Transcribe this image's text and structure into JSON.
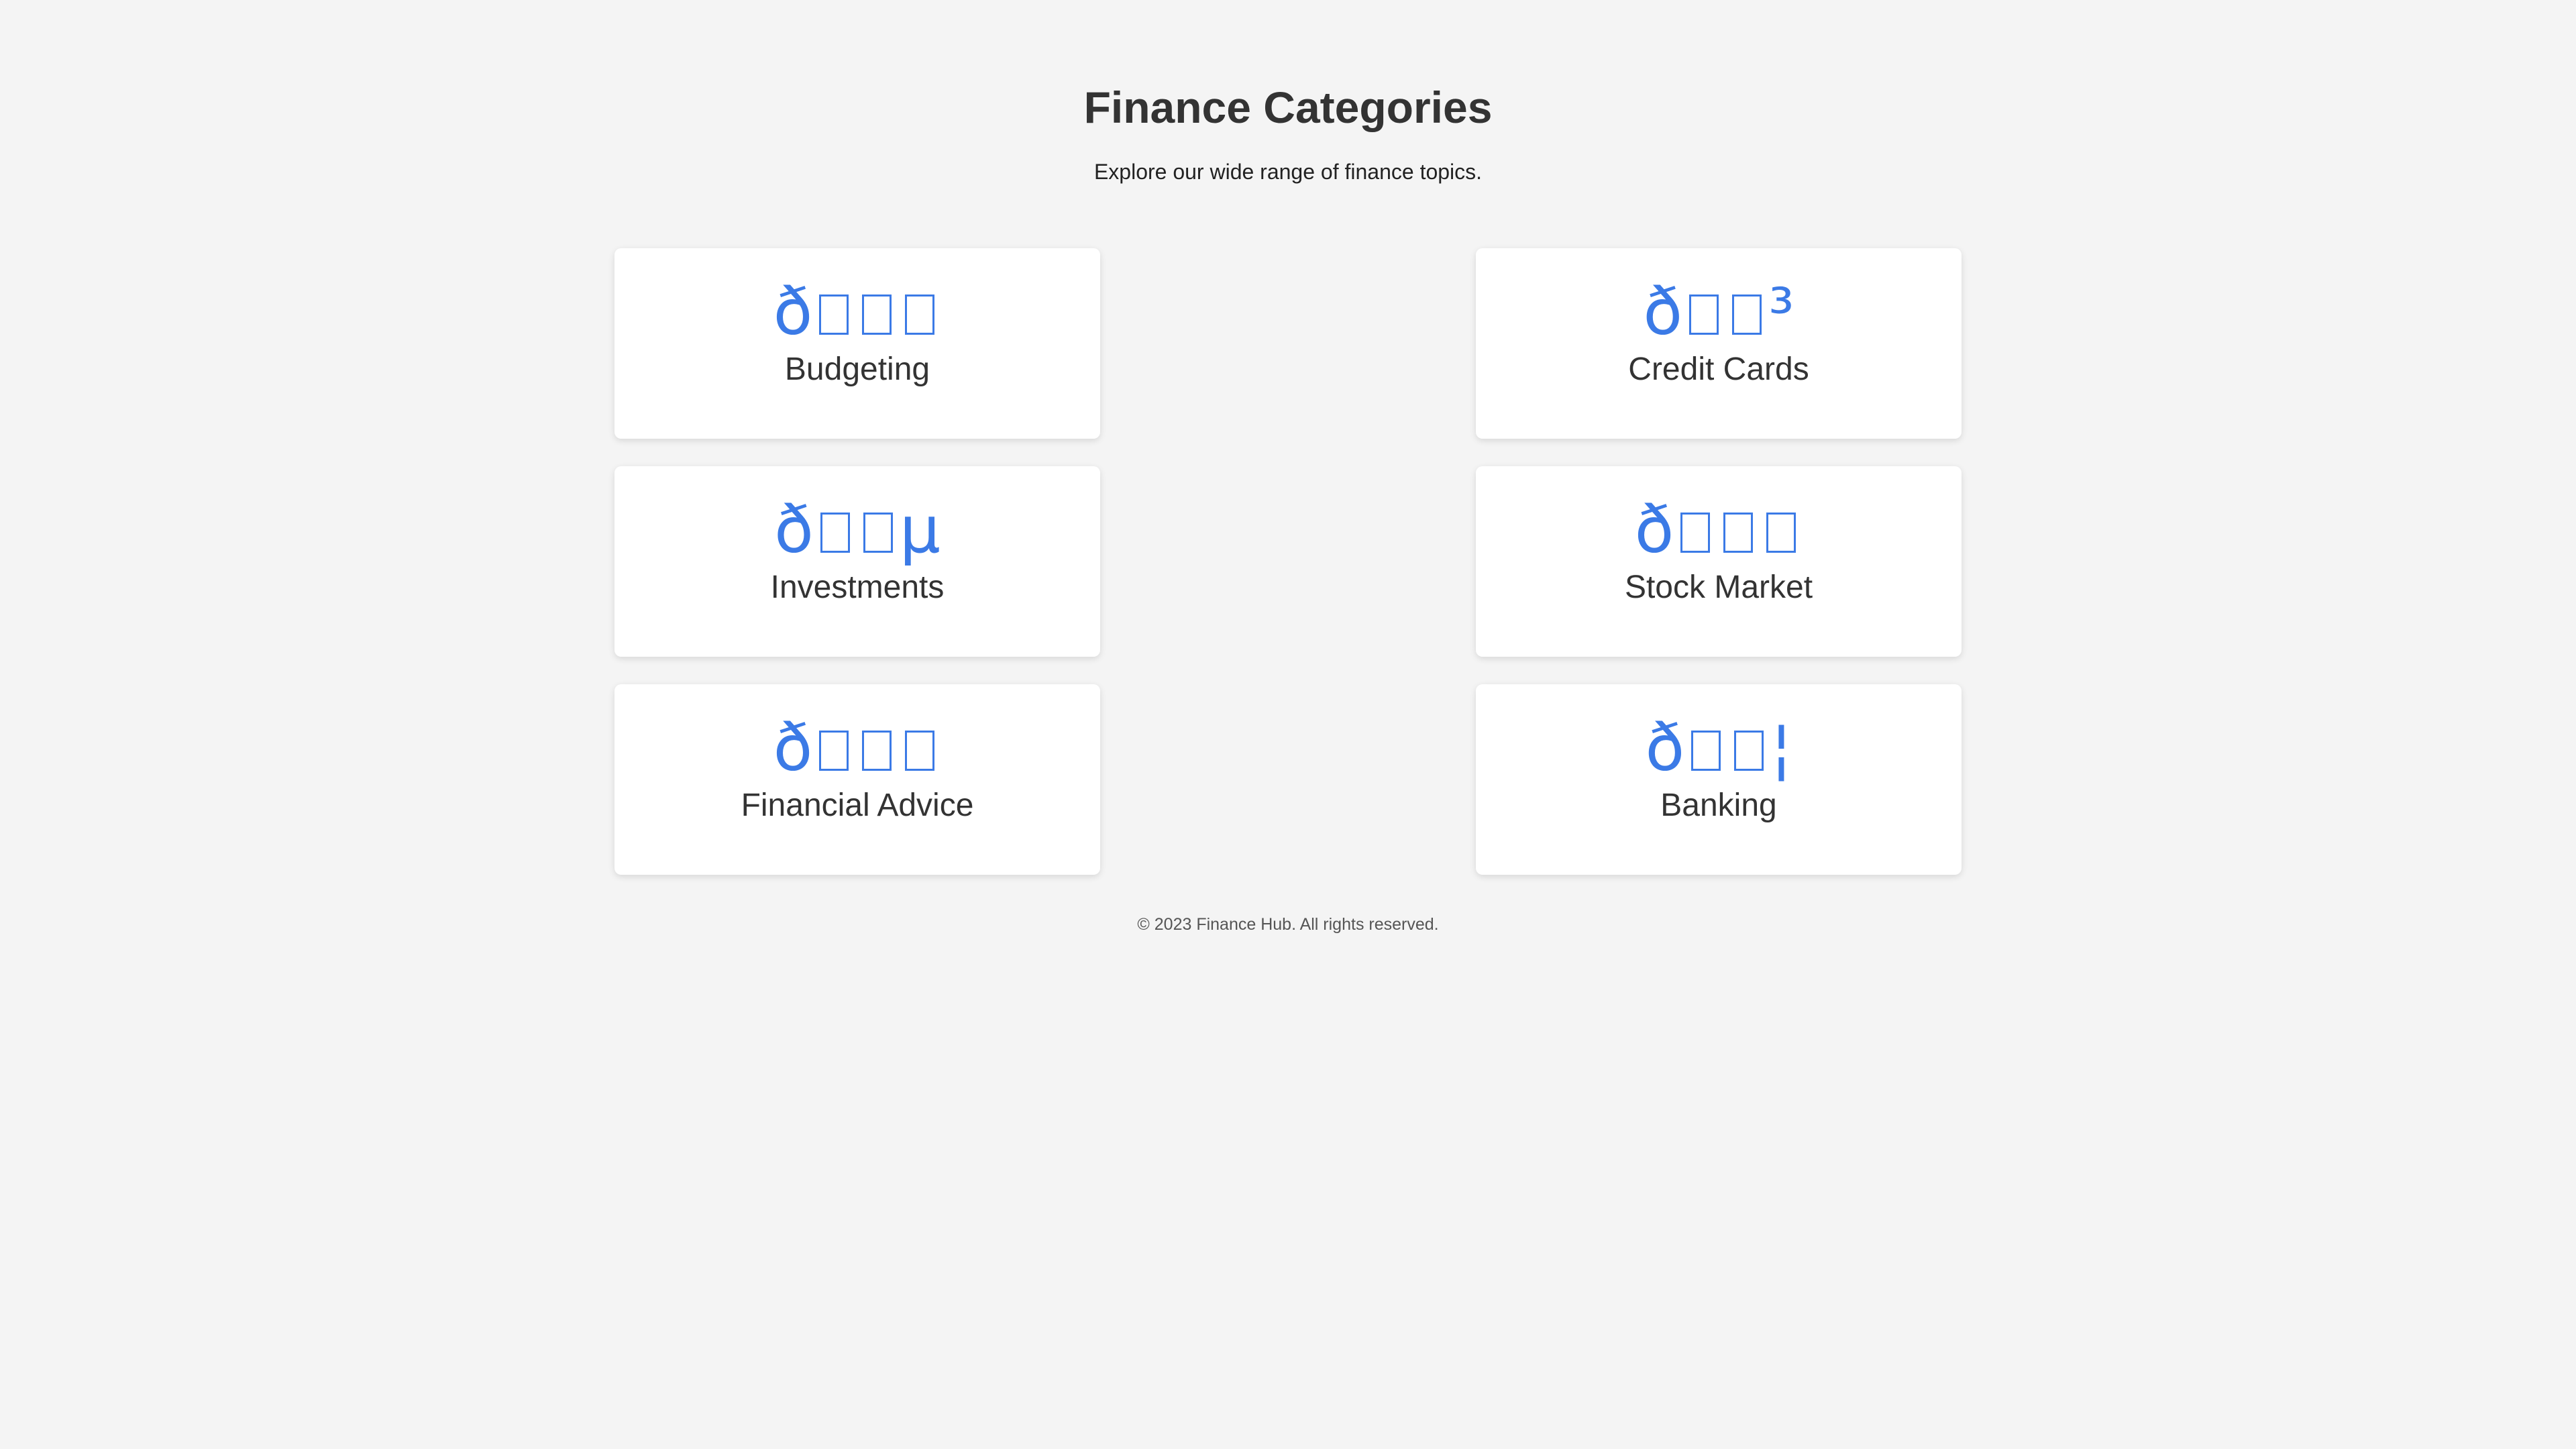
{
  "header": {
    "title": "Finance Categories",
    "subtitle": "Explore our wide range of finance topics."
  },
  "categories": [
    {
      "label": "Budgeting",
      "icon_name": "budget-icon",
      "icon_prefix": "ð",
      "icon_suffix": ""
    },
    {
      "label": "Credit Cards",
      "icon_name": "credit-card-icon",
      "icon_prefix": "ð",
      "icon_suffix": "³"
    },
    {
      "label": "Investments",
      "icon_name": "investment-icon",
      "icon_prefix": "ð",
      "icon_suffix": "µ"
    },
    {
      "label": "Stock Market",
      "icon_name": "stock-chart-icon",
      "icon_prefix": "ð",
      "icon_suffix": ""
    },
    {
      "label": "Financial Advice",
      "icon_name": "advice-icon",
      "icon_prefix": "ð",
      "icon_suffix": ""
    },
    {
      "label": "Banking",
      "icon_name": "bank-icon",
      "icon_prefix": "ð",
      "icon_suffix": "¦"
    }
  ],
  "footer": {
    "text": "© 2023 Finance Hub. All rights reserved."
  },
  "colors": {
    "background": "#f4f4f4",
    "card": "#ffffff",
    "accent": "#3b7ae6",
    "text": "#333333"
  }
}
